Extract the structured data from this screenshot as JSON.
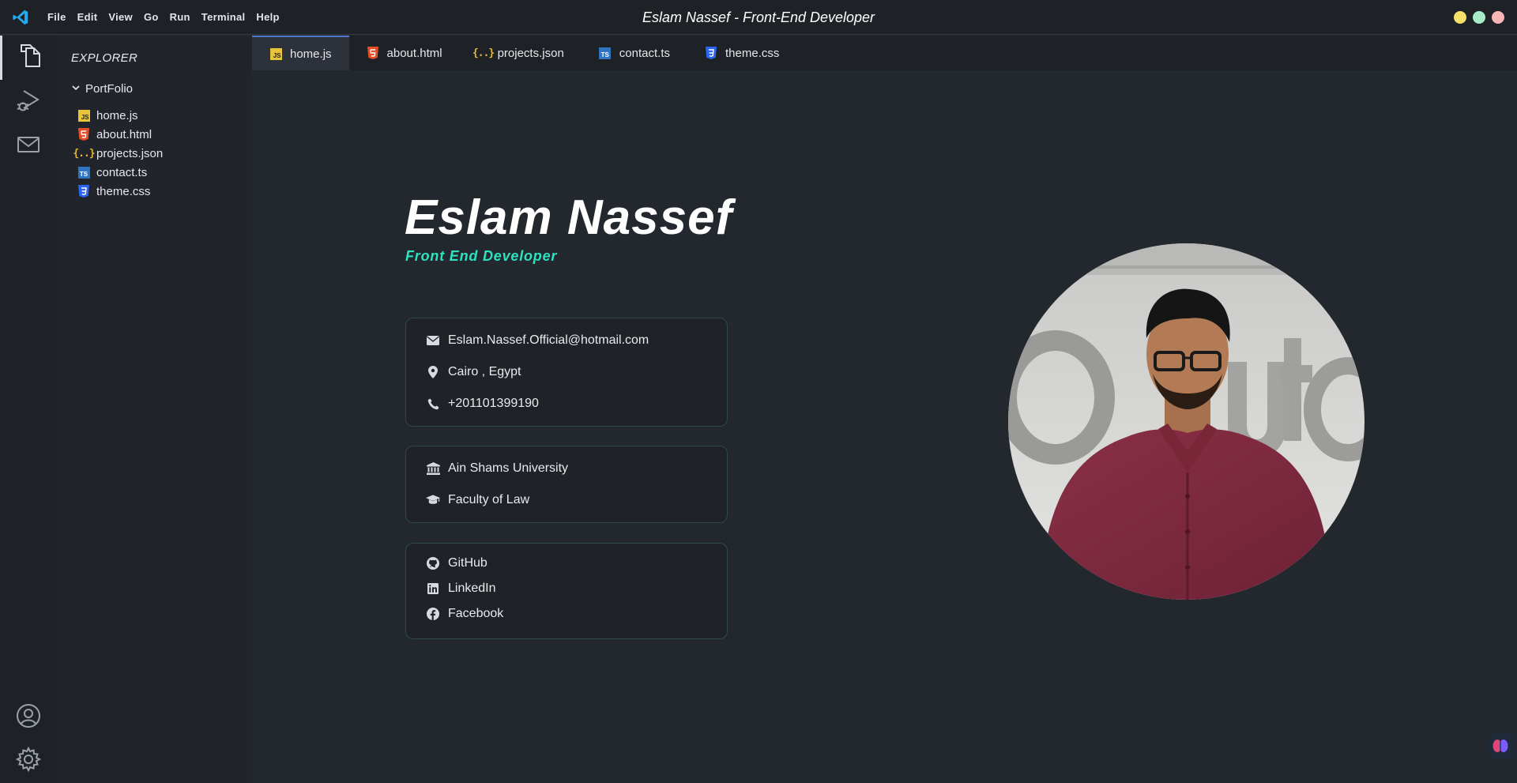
{
  "window": {
    "title": "Eslam Nassef - Front-End Developer",
    "menu": [
      "File",
      "Edit",
      "View",
      "Go",
      "Run",
      "Terminal",
      "Help"
    ],
    "traffic_colors": [
      "#f5e06a",
      "#a8ecc8",
      "#f6b6b6"
    ]
  },
  "activity_bar": {
    "top_icons": [
      "files-icon",
      "run-debug-icon",
      "mail-icon"
    ],
    "bottom_icons": [
      "account-icon",
      "settings-gear-icon"
    ]
  },
  "sidebar": {
    "title": "EXPLORER",
    "folder": "PortFolio",
    "files": [
      {
        "name": "home.js",
        "icon": "js-file-icon"
      },
      {
        "name": "about.html",
        "icon": "html-file-icon"
      },
      {
        "name": "projects.json",
        "icon": "json-file-icon"
      },
      {
        "name": "contact.ts",
        "icon": "ts-file-icon"
      },
      {
        "name": "theme.css",
        "icon": "css-file-icon"
      }
    ]
  },
  "tabs": [
    {
      "label": "home.js",
      "active": true
    },
    {
      "label": "about.html",
      "active": false
    },
    {
      "label": "projects.json",
      "active": false
    },
    {
      "label": "contact.ts",
      "active": false
    },
    {
      "label": "theme.css",
      "active": false
    }
  ],
  "hero": {
    "name": "Eslam Nassef",
    "role": "Front End Developer"
  },
  "contact_card": {
    "email": "Eslam.Nassef.Official@hotmail.com",
    "location": "Cairo , Egypt",
    "phone": "+201101399190"
  },
  "education_card": {
    "university": "Ain Shams University",
    "faculty": "Faculty of Law"
  },
  "social_card": {
    "links": [
      "GitHub",
      "LinkedIn",
      "Facebook"
    ]
  },
  "colors": {
    "accent": "#2ee2c0",
    "background": "#23272e",
    "card_border": "#2c4a46"
  }
}
